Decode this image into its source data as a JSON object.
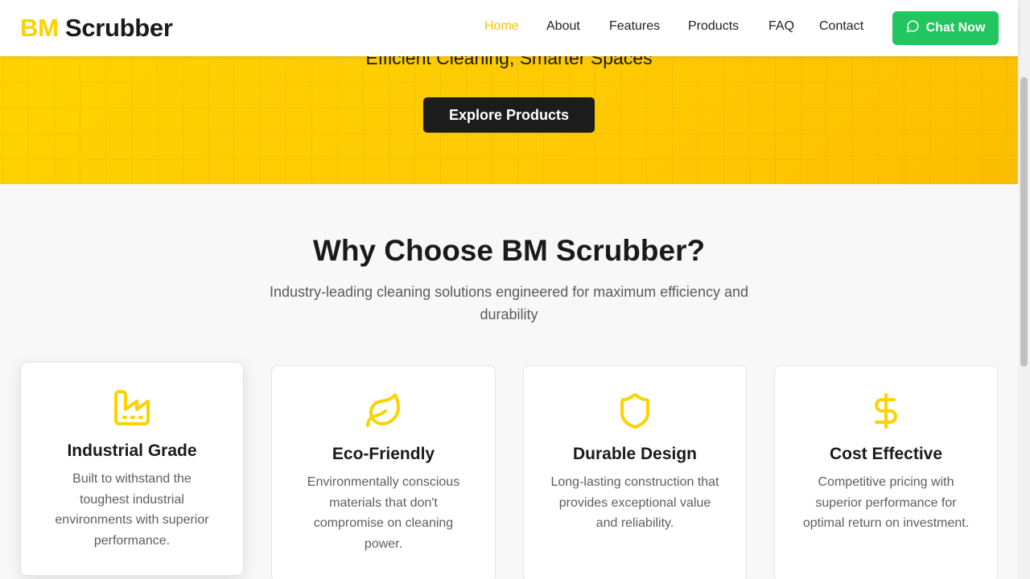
{
  "brand": {
    "bm": "BM",
    "rest": " Scrubber",
    "accent": "#fcd200"
  },
  "nav": {
    "items": [
      {
        "label": "Home",
        "active": true
      },
      {
        "label": "About"
      },
      {
        "label": "Features"
      },
      {
        "label": "Products"
      },
      {
        "label": "FAQ"
      },
      {
        "label": "Contact"
      }
    ],
    "chat_label": "Chat Now",
    "chat_icon": "message-circle-icon",
    "chat_color": "#22c55e"
  },
  "hero": {
    "tagline": "Efficient Cleaning, Smarter Spaces",
    "cta_label": "Explore Products"
  },
  "features": {
    "title": "Why Choose BM Scrubber?",
    "subtitle": "Industry-leading cleaning solutions engineered for maximum efficiency and durability",
    "cards": [
      {
        "icon": "factory-icon",
        "title": "Industrial Grade",
        "text": "Built to withstand the toughest industrial environments with superior performance."
      },
      {
        "icon": "leaf-icon",
        "title": "Eco-Friendly",
        "text": "Environmentally conscious materials that don't compromise on cleaning power."
      },
      {
        "icon": "shield-icon",
        "title": "Durable Design",
        "text": "Long-lasting construction that provides exceptional value and reliability."
      },
      {
        "icon": "dollar-sign-icon",
        "title": "Cost Effective",
        "text": "Competitive pricing with superior performance for optimal return on investment."
      }
    ]
  }
}
